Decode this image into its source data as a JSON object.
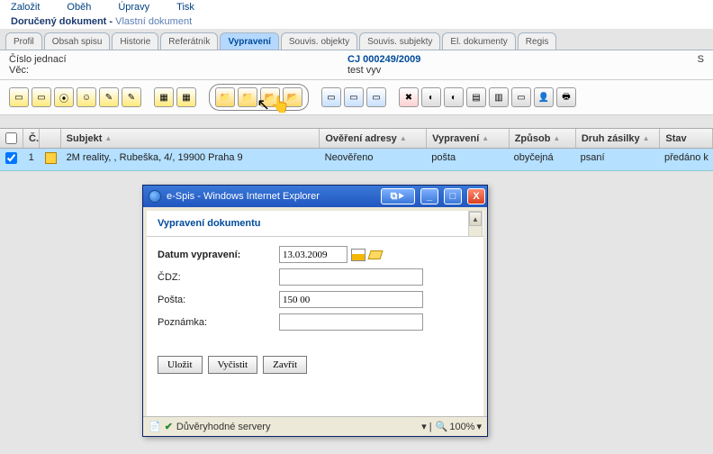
{
  "menu": {
    "i0": "Založit",
    "i1": "Oběh",
    "i2": "Úpravy",
    "i3": "Tisk"
  },
  "title": {
    "main": "Doručený dokument",
    "sub": "Vlastní dokument"
  },
  "tabs": {
    "t0": "Profil",
    "t1": "Obsah spisu",
    "t2": "Historie",
    "t3": "Referátník",
    "t4": "Vypravení",
    "t5": "Souvis. objekty",
    "t6": "Souvis. subjekty",
    "t7": "El. dokumenty",
    "t8": "Regis"
  },
  "info": {
    "cjLabel": "Číslo jednací",
    "cjVal": "CJ 000249/2009",
    "vecLabel": "Věc:",
    "vecVal": "test vyv",
    "sLabel": "S"
  },
  "grid": {
    "h0": "Č.",
    "h1": "Subjekt",
    "h2": "Ověření adresy",
    "h3": "Vypravení",
    "h4": "Způsob",
    "h5": "Druh zásilky",
    "h6": "Stav",
    "r0": {
      "num": "1",
      "subj": "2M reality, , Rubeška, 4/, 19900 Praha 9",
      "over": "Neověřeno",
      "vypr": "pošta",
      "zpus": "obyčejná",
      "druh": "psaní",
      "stav": "předáno k"
    }
  },
  "dialog": {
    "title": "e-Spis - Windows Internet Explorer",
    "heading": "Vypravení dokumentu",
    "datumLab": "Datum vypravení:",
    "datumVal": "13.03.2009",
    "cdzLab": "ČDZ:",
    "cdzVal": "",
    "postaLab": "Pošta:",
    "postaVal": "150 00",
    "poznLab": "Poznámka:",
    "poznVal": "",
    "btnSave": "Uložit",
    "btnClear": "Vyčistit",
    "btnClose": "Zavřít",
    "status": "Důvěryhodné servery",
    "zoom": "100%"
  }
}
